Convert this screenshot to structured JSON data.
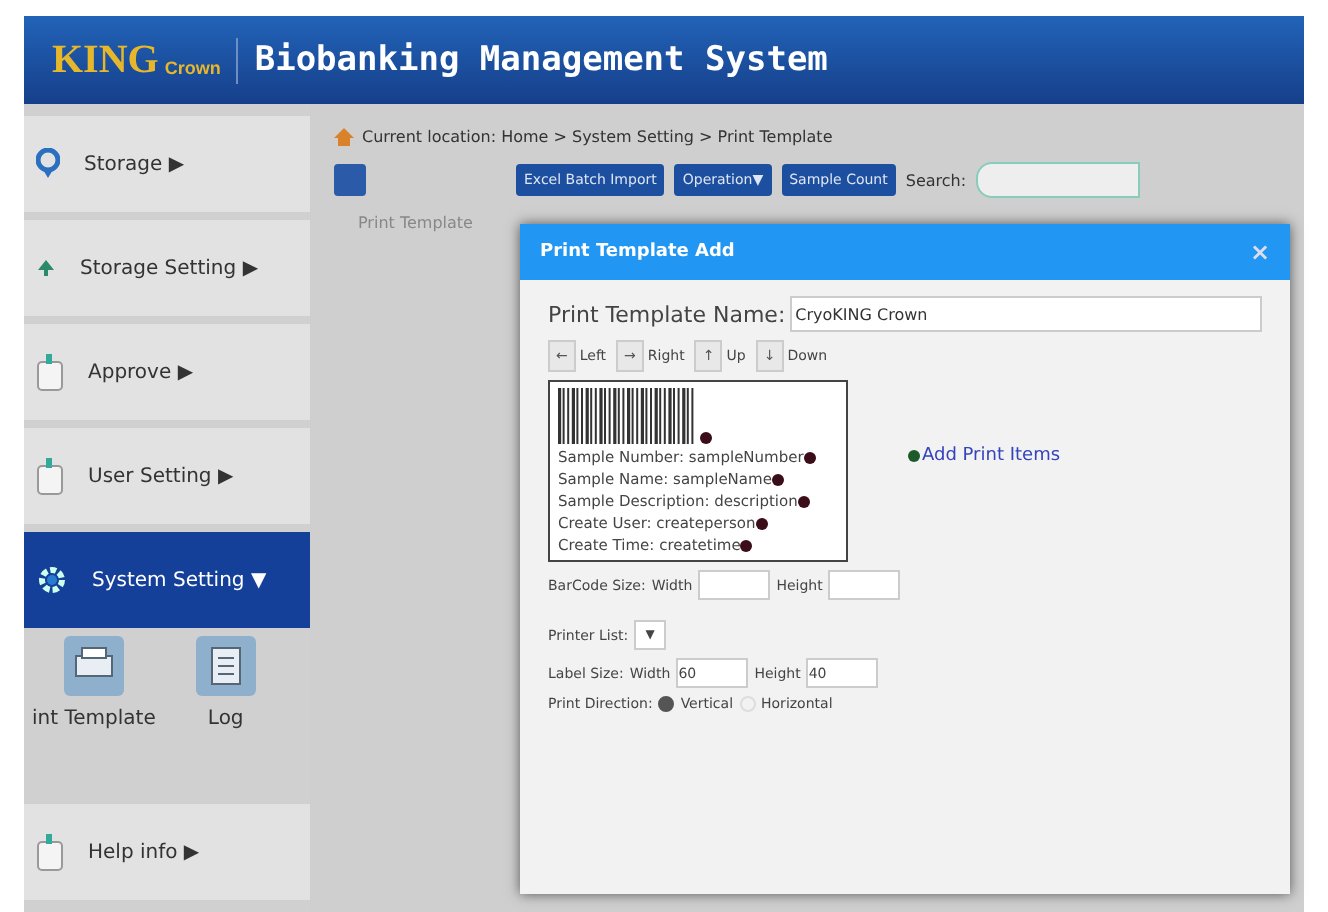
{
  "header": {
    "logo_main": "KING",
    "logo_sub": "Crown",
    "title": "Biobanking Management System"
  },
  "sidebar": {
    "items": [
      {
        "label": "Storage",
        "arrow": "▶",
        "selected": false,
        "kind": "pin"
      },
      {
        "label": "Storage Setting",
        "arrow": "▶",
        "selected": false,
        "kind": "up"
      },
      {
        "label": "Approve",
        "arrow": "▶",
        "selected": false,
        "kind": "doc"
      },
      {
        "label": "User Setting",
        "arrow": "▶",
        "selected": false,
        "kind": "doc"
      },
      {
        "label": "System Setting",
        "arrow": "▼",
        "selected": true,
        "kind": "gear"
      }
    ],
    "subitems": [
      {
        "label": "int Template",
        "kind": "print"
      },
      {
        "label": "Log",
        "kind": "log"
      }
    ],
    "footer_item": {
      "label": "Help info",
      "arrow": "▶"
    }
  },
  "breadcrumb": "Current location: Home > System Setting > Print Template",
  "toolbar": {
    "buttons": [
      "Excel Batch Import",
      "Operation▼",
      "Sample Count"
    ],
    "search_label": "Search:"
  },
  "content_label": "Print Template",
  "dialog": {
    "title": "Print Template Add",
    "close": "×",
    "name_label": "Print Template Name:",
    "name_value": "CryoKING Crown",
    "moves": [
      {
        "arrow": "←",
        "label": "Left"
      },
      {
        "arrow": "→",
        "label": "Right"
      },
      {
        "arrow": "↑",
        "label": "Up"
      },
      {
        "arrow": "↓",
        "label": "Down"
      }
    ],
    "add_link": "Add Print Items",
    "label_lines": [
      "Sample Number: sampleNumber",
      "Sample Name: sampleName",
      "Sample Description: description",
      "Create User: createperson",
      "Create Time: createtime"
    ],
    "barcode_size": {
      "label": "BarCode Size:",
      "width_label": "Width",
      "height_label": "Height"
    },
    "printer_list": {
      "label": "Printer List:",
      "caret": "▼"
    },
    "label_size": {
      "label": "Label Size:",
      "width_label": "Width",
      "width_value": "60",
      "height_label": "Height",
      "height_value": "40"
    },
    "print_direction": {
      "label": "Print Direction:",
      "options": [
        {
          "label": "Vertical",
          "selected": true
        },
        {
          "label": "Horizontal",
          "selected": false
        }
      ]
    }
  }
}
